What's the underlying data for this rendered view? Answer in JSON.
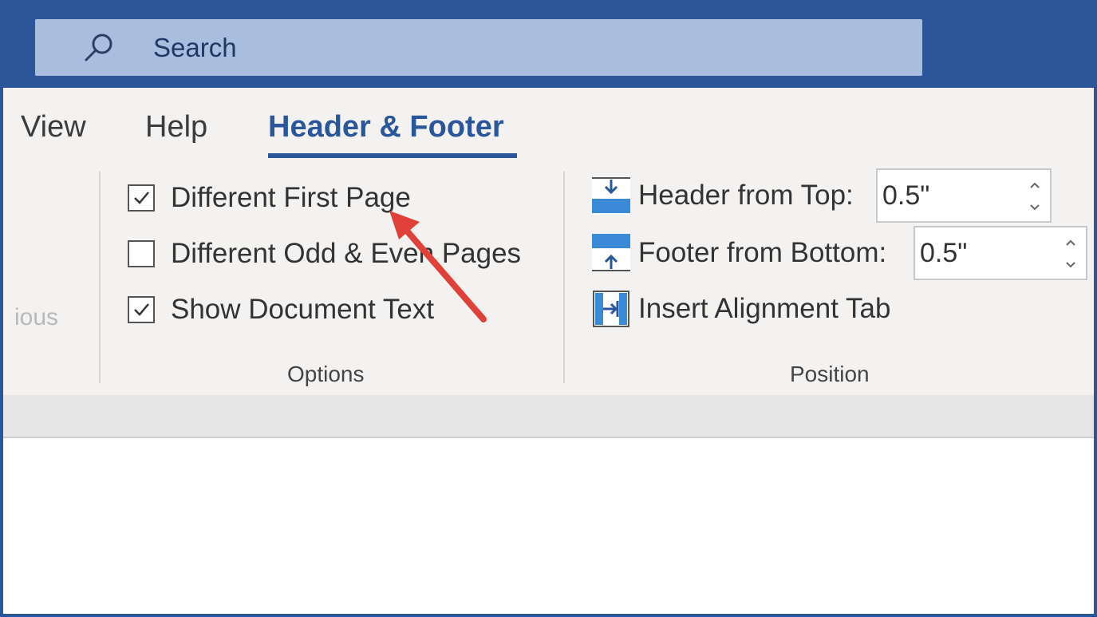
{
  "search": {
    "label": "Search"
  },
  "tabs": [
    {
      "label": "View"
    },
    {
      "label": "Help"
    },
    {
      "label": "Header & Footer",
      "active": true
    }
  ],
  "left_group": {
    "partial_label": "ious"
  },
  "options_group": {
    "label": "Options",
    "items": [
      {
        "label": "Different First Page",
        "checked": true
      },
      {
        "label": "Different Odd & Even Pages",
        "checked": false
      },
      {
        "label": "Show Document Text",
        "checked": true
      }
    ]
  },
  "position_group": {
    "label": "Position",
    "header_from_top": {
      "label": "Header from Top:",
      "value": "0.5\"",
      "icon": "header-from-top-icon"
    },
    "footer_from_bottom": {
      "label": "Footer from Bottom:",
      "value": "0.5\"",
      "icon": "footer-from-bottom-icon"
    },
    "insert_alignment_tab": {
      "label": "Insert Alignment Tab",
      "icon": "insert-alignment-tab-icon"
    }
  },
  "colors": {
    "accent": "#2b579a",
    "search_bg": "#a9bedf",
    "ribbon_bg": "#f3f2f1",
    "annotation_arrow": "#e0403a"
  }
}
